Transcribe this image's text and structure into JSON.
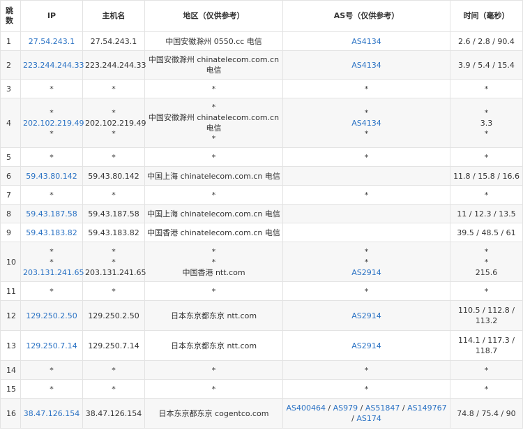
{
  "headers": {
    "hop": "跳数",
    "ip": "IP",
    "host": "主机名",
    "region": "地区（仅供参考）",
    "as": "AS号（仅供参考）",
    "time": "时间（毫秒）"
  },
  "rows": [
    {
      "hop": "1",
      "ip": [
        "27.54.243.1"
      ],
      "host": [
        "27.54.243.1"
      ],
      "region": [
        "中国安徽滁州 0550.cc 电信"
      ],
      "as": [
        "AS4134"
      ],
      "time": [
        "2.6 / 2.8 / 90.4"
      ]
    },
    {
      "hop": "2",
      "ip": [
        "223.244.244.33"
      ],
      "host": [
        "223.244.244.33"
      ],
      "region": [
        "中国安徽滁州 chinatelecom.com.cn",
        "电信"
      ],
      "as": [
        "AS4134"
      ],
      "time": [
        "3.9 / 5.4 / 15.4"
      ]
    },
    {
      "hop": "3",
      "ip": [
        "*"
      ],
      "host": [
        "*"
      ],
      "region": [
        "*"
      ],
      "as": [
        "*"
      ],
      "time": [
        "*"
      ]
    },
    {
      "hop": "4",
      "ip": [
        "*",
        "202.102.219.49",
        "*"
      ],
      "host": [
        "*",
        "202.102.219.49",
        "*"
      ],
      "region": [
        "*",
        "中国安徽滁州 chinatelecom.com.cn",
        "电信",
        "*"
      ],
      "as": [
        "*",
        "AS4134",
        "*"
      ],
      "time": [
        "*",
        "3.3",
        "*"
      ]
    },
    {
      "hop": "5",
      "ip": [
        "*"
      ],
      "host": [
        "*"
      ],
      "region": [
        "*"
      ],
      "as": [
        "*"
      ],
      "time": [
        "*"
      ]
    },
    {
      "hop": "6",
      "ip": [
        "59.43.80.142"
      ],
      "host": [
        "59.43.80.142"
      ],
      "region": [
        "中国上海 chinatelecom.com.cn 电信"
      ],
      "as": [],
      "time": [
        "11.8 / 15.8 / 16.6"
      ]
    },
    {
      "hop": "7",
      "ip": [
        "*"
      ],
      "host": [
        "*"
      ],
      "region": [
        "*"
      ],
      "as": [
        "*"
      ],
      "time": [
        "*"
      ]
    },
    {
      "hop": "8",
      "ip": [
        "59.43.187.58"
      ],
      "host": [
        "59.43.187.58"
      ],
      "region": [
        "中国上海 chinatelecom.com.cn 电信"
      ],
      "as": [],
      "time": [
        "11 / 12.3 / 13.5"
      ]
    },
    {
      "hop": "9",
      "ip": [
        "59.43.183.82"
      ],
      "host": [
        "59.43.183.82"
      ],
      "region": [
        "中国香港 chinatelecom.com.cn 电信"
      ],
      "as": [],
      "time": [
        "39.5 / 48.5 / 61"
      ]
    },
    {
      "hop": "10",
      "ip": [
        "*",
        "*",
        "203.131.241.65"
      ],
      "host": [
        "*",
        "*",
        "203.131.241.65"
      ],
      "region": [
        "*",
        "*",
        "中国香港 ntt.com"
      ],
      "as": [
        "*",
        "*",
        "AS2914"
      ],
      "time": [
        "*",
        "*",
        "215.6"
      ]
    },
    {
      "hop": "11",
      "ip": [
        "*"
      ],
      "host": [
        "*"
      ],
      "region": [
        "*"
      ],
      "as": [
        "*"
      ],
      "time": [
        "*"
      ]
    },
    {
      "hop": "12",
      "ip": [
        "129.250.2.50"
      ],
      "host": [
        "129.250.2.50"
      ],
      "region": [
        "日本东京都东京 ntt.com"
      ],
      "as": [
        "AS2914"
      ],
      "time": [
        "110.5 / 112.8 /",
        "113.2"
      ]
    },
    {
      "hop": "13",
      "ip": [
        "129.250.7.14"
      ],
      "host": [
        "129.250.7.14"
      ],
      "region": [
        "日本东京都东京 ntt.com"
      ],
      "as": [
        "AS2914"
      ],
      "time": [
        "114.1 / 117.3 /",
        "118.7"
      ]
    },
    {
      "hop": "14",
      "ip": [
        "*"
      ],
      "host": [
        "*"
      ],
      "region": [
        "*"
      ],
      "as": [
        "*"
      ],
      "time": [
        "*"
      ]
    },
    {
      "hop": "15",
      "ip": [
        "*"
      ],
      "host": [
        "*"
      ],
      "region": [
        "*"
      ],
      "as": [
        "*"
      ],
      "time": [
        "*"
      ]
    },
    {
      "hop": "16",
      "ip": [
        "38.47.126.154"
      ],
      "host": [
        "38.47.126.154"
      ],
      "region": [
        "日本东京都东京 cogentco.com"
      ],
      "as": [
        "AS400464",
        "AS979",
        "AS51847",
        "AS149767",
        "AS174"
      ],
      "as_inline": true,
      "time": [
        "74.8 / 75.4 / 90"
      ]
    }
  ],
  "colors": {
    "link": "#2a72c4",
    "stripe": "#f7f7f7",
    "border": "#e3e3e3",
    "text": "#333333"
  }
}
